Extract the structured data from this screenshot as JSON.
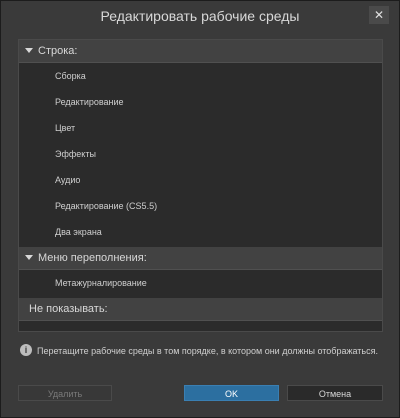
{
  "window": {
    "title": "Редактировать рабочие среды",
    "close_glyph": "✕"
  },
  "sections": {
    "row": {
      "label": "Строка:",
      "items": [
        "Сборка",
        "Редактирование",
        "Цвет",
        "Эффекты",
        "Аудио",
        "Редактирование (CS5.5)",
        "Два экрана"
      ]
    },
    "overflow": {
      "label": "Меню переполнения:",
      "items": [
        "Метажурналирование"
      ]
    },
    "hidden": {
      "label": "Не показывать:"
    }
  },
  "info": {
    "icon": "info-icon",
    "glyph": "i",
    "text": "Перетащите рабочие среды в том порядке, в котором они должны отображаться."
  },
  "buttons": {
    "delete_label": "Удалить",
    "ok_label": "OK",
    "cancel_label": "Отмена"
  },
  "colors": {
    "accent": "#2c6fa0",
    "background": "#3a3a3a",
    "panel": "#2b2b2b"
  }
}
